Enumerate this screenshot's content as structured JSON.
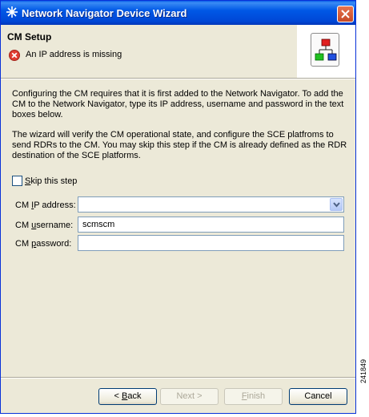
{
  "window": {
    "title": "Network Navigator Device Wizard"
  },
  "header": {
    "title": "CM Setup",
    "error": "An IP address is missing"
  },
  "body": {
    "paragraph1": "Configuring the CM requires that it is first added to the Network Navigator. To add the CM to the Network Navigator, type its IP address, username and password in the text boxes below.",
    "paragraph2": "The wizard will verify the CM operational state, and configure the SCE platfroms to send RDRs to the CM. You may skip this step if the CM is already defined as the RDR destination of the SCE platforms."
  },
  "skip_checkbox": {
    "label_mnemonic": "S",
    "label_rest": "kip this step",
    "checked": false
  },
  "fields": {
    "ip": {
      "label_pre": "CM ",
      "label_mnemonic": "I",
      "label_post": "P address:",
      "value": ""
    },
    "username": {
      "label_pre": "CM ",
      "label_mnemonic": "u",
      "label_post": "sername:",
      "value": "scmscm"
    },
    "password": {
      "label_pre": "CM ",
      "label_mnemonic": "p",
      "label_post": "assword:",
      "value": ""
    }
  },
  "buttons": {
    "back": {
      "pre": "< ",
      "mnemonic": "B",
      "post": "ack"
    },
    "next": "Next >",
    "finish_mnemonic": "F",
    "finish_rest": "inish",
    "cancel": "Cancel"
  },
  "figure_id": "241849",
  "colors": {
    "titlebar": "#0058e6",
    "dialog_bg": "#ece9d8",
    "error": "#e03c31"
  }
}
